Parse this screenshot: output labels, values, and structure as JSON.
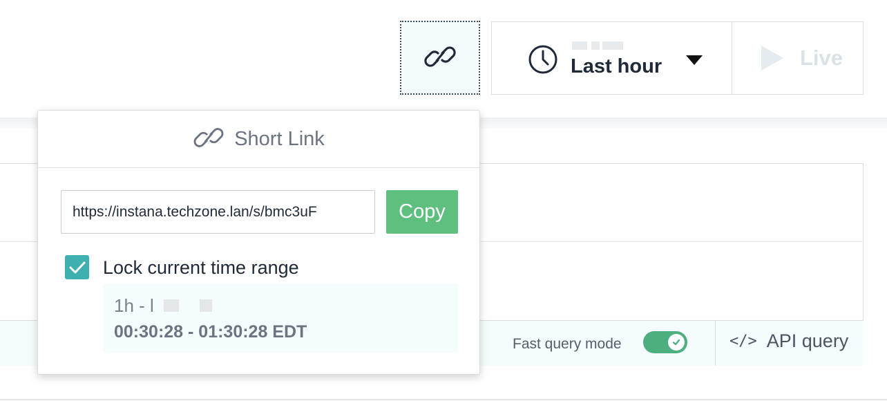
{
  "toolbar": {
    "share_icon": "link-icon",
    "time_picker": {
      "icon": "clock-icon",
      "label": "Last hour",
      "caret_icon": "caret-down-icon"
    },
    "live": {
      "icon": "play-icon",
      "label": "Live"
    }
  },
  "query_bar": {
    "fast_query_label": "Fast query mode",
    "fast_query_enabled": true,
    "api_query_icon": "code-icon",
    "api_query_label": "API query"
  },
  "share_popover": {
    "title_icon": "link-icon",
    "title": "Short Link",
    "url": "https://instana.techzone.lan/s/bmc3uF",
    "copy_label": "Copy",
    "lock": {
      "checked": true,
      "label": "Lock current time range"
    },
    "range_short": "1h - l",
    "range_time": "00:30:28 - 01:30:28 EDT"
  },
  "colors": {
    "accent_green": "#5fbf7f",
    "checkbox_teal": "#3fb0b0",
    "toggle_green": "#4caf7d"
  }
}
